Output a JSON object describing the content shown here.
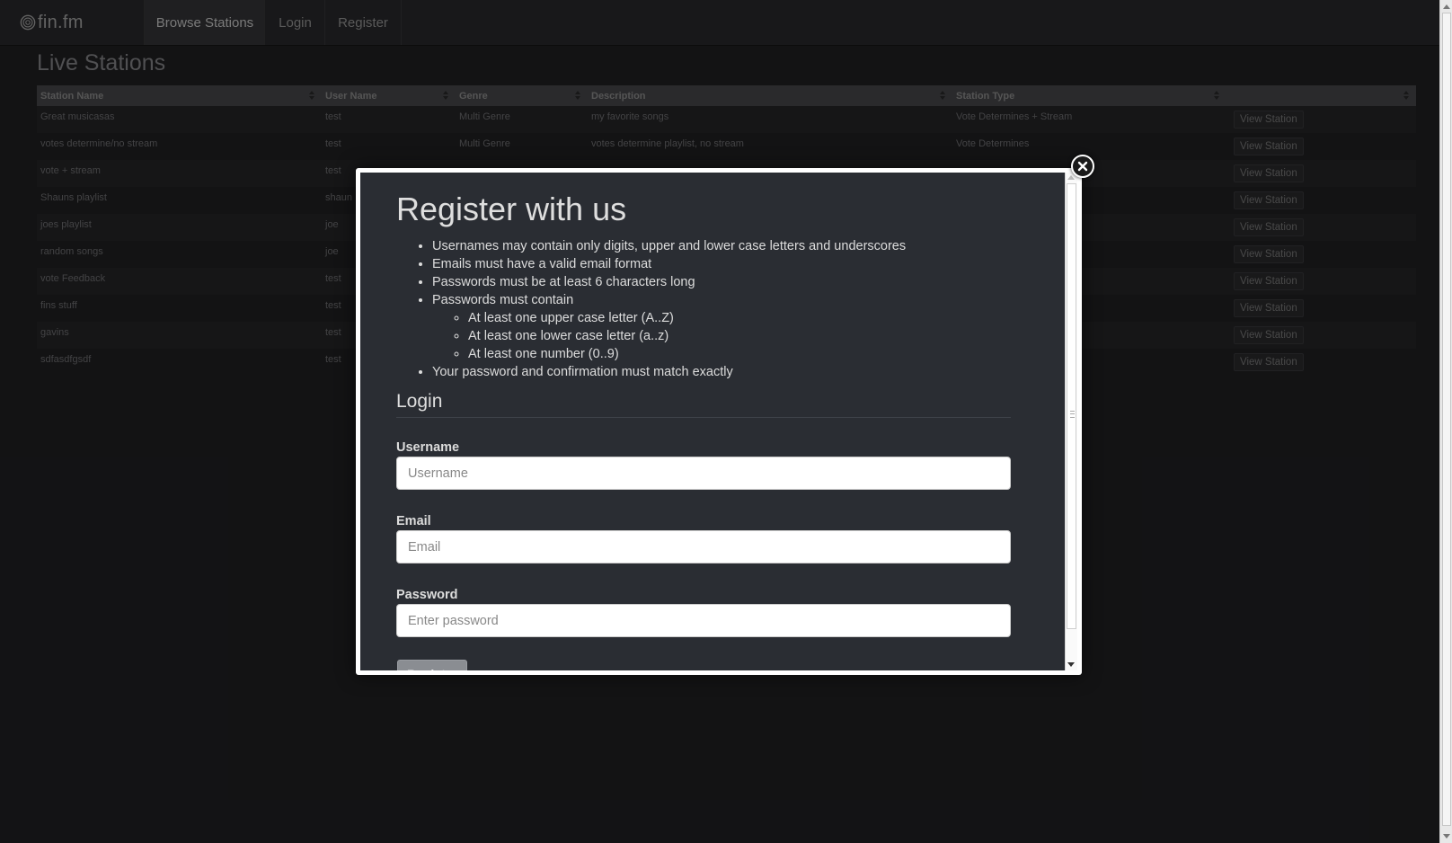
{
  "nav": {
    "brand": "fin.fm",
    "items": [
      {
        "label": "Browse Stations",
        "active": true
      },
      {
        "label": "Login",
        "active": false
      },
      {
        "label": "Register",
        "active": false
      }
    ]
  },
  "page": {
    "title": "Live Stations"
  },
  "table": {
    "headers": [
      "Station Name",
      "User Name",
      "Genre",
      "Description",
      "Station Type",
      ""
    ],
    "action_label": "View Station",
    "rows": [
      {
        "name": "Great musicasas",
        "user": "test",
        "genre": "Multi Genre",
        "description": "my favorite songs",
        "type": "Vote Determines + Stream"
      },
      {
        "name": "votes determine/no stream",
        "user": "test",
        "genre": "Multi Genre",
        "description": "votes determine playlist, no stream",
        "type": "Vote Determines"
      },
      {
        "name": "vote + stream",
        "user": "test",
        "genre": "",
        "description": "",
        "type": ""
      },
      {
        "name": "Shauns playlist",
        "user": "shaun",
        "genre": "",
        "description": "",
        "type": ""
      },
      {
        "name": "joes playlist",
        "user": "joe",
        "genre": "",
        "description": "",
        "type": ""
      },
      {
        "name": "random songs",
        "user": "joe",
        "genre": "",
        "description": "",
        "type": ""
      },
      {
        "name": "vote Feedback",
        "user": "test",
        "genre": "",
        "description": "",
        "type": ""
      },
      {
        "name": "fins stuff",
        "user": "test",
        "genre": "",
        "description": "",
        "type": ""
      },
      {
        "name": "gavins",
        "user": "test",
        "genre": "",
        "description": "",
        "type": ""
      },
      {
        "name": "sdfasdfgsdf",
        "user": "test",
        "genre": "",
        "description": "",
        "type": ""
      }
    ]
  },
  "modal": {
    "title": "Register with us",
    "rules": [
      "Usernames may contain only digits, upper and lower case letters and underscores",
      "Emails must have a valid email format",
      "Passwords must be at least 6 characters long",
      "Passwords must contain"
    ],
    "sub_rules": [
      "At least one upper case letter (A..Z)",
      "At least one lower case letter (a..z)",
      "At least one number (0..9)"
    ],
    "final_rule": "Your password and confirmation must match exactly",
    "section": "Login",
    "fields": {
      "username": {
        "label": "Username",
        "placeholder": "Username",
        "value": ""
      },
      "email": {
        "label": "Email",
        "placeholder": "Email",
        "value": ""
      },
      "password": {
        "label": "Password",
        "placeholder": "Enter password",
        "value": ""
      }
    },
    "submit_label": "Register"
  }
}
